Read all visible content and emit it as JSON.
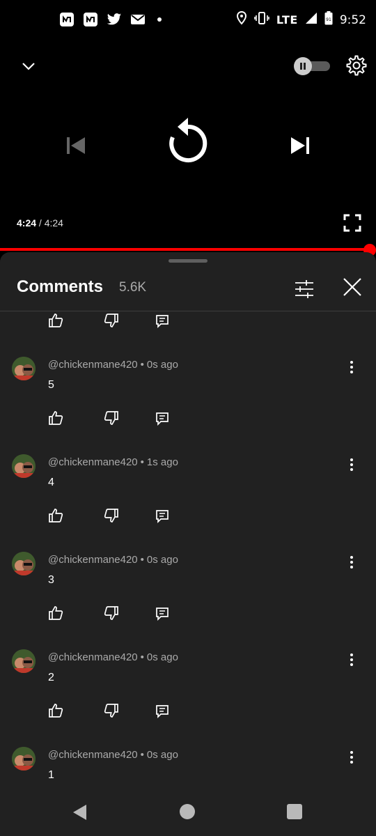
{
  "status_bar": {
    "network": "LTE",
    "time": "9:52",
    "battery": "91",
    "left_icons": [
      "nfc-icon",
      "nfc-icon",
      "twitter-icon",
      "mail-icon",
      "dot-icon"
    ],
    "right_icons": [
      "location-icon",
      "vibrate-icon",
      "signal-icon",
      "battery-icon"
    ]
  },
  "player": {
    "current_time": "4:24",
    "separator": "/",
    "duration": "4:24",
    "progress": 1.0,
    "autoplay": "paused",
    "accent_color": "#ff0000"
  },
  "comments_panel": {
    "title": "Comments",
    "count": "5.6K",
    "items": [
      {
        "author": "@chickenmane420",
        "separator": "•",
        "time": "0s ago",
        "text": "5"
      },
      {
        "author": "@chickenmane420",
        "separator": "•",
        "time": "1s ago",
        "text": "4"
      },
      {
        "author": "@chickenmane420",
        "separator": "•",
        "time": "0s ago",
        "text": "3"
      },
      {
        "author": "@chickenmane420",
        "separator": "•",
        "time": "0s ago",
        "text": "2"
      },
      {
        "author": "@chickenmane420",
        "separator": "•",
        "time": "0s ago",
        "text": "1"
      }
    ]
  },
  "nav_bar": {
    "icons": [
      "back-icon",
      "home-icon",
      "recents-icon"
    ]
  }
}
